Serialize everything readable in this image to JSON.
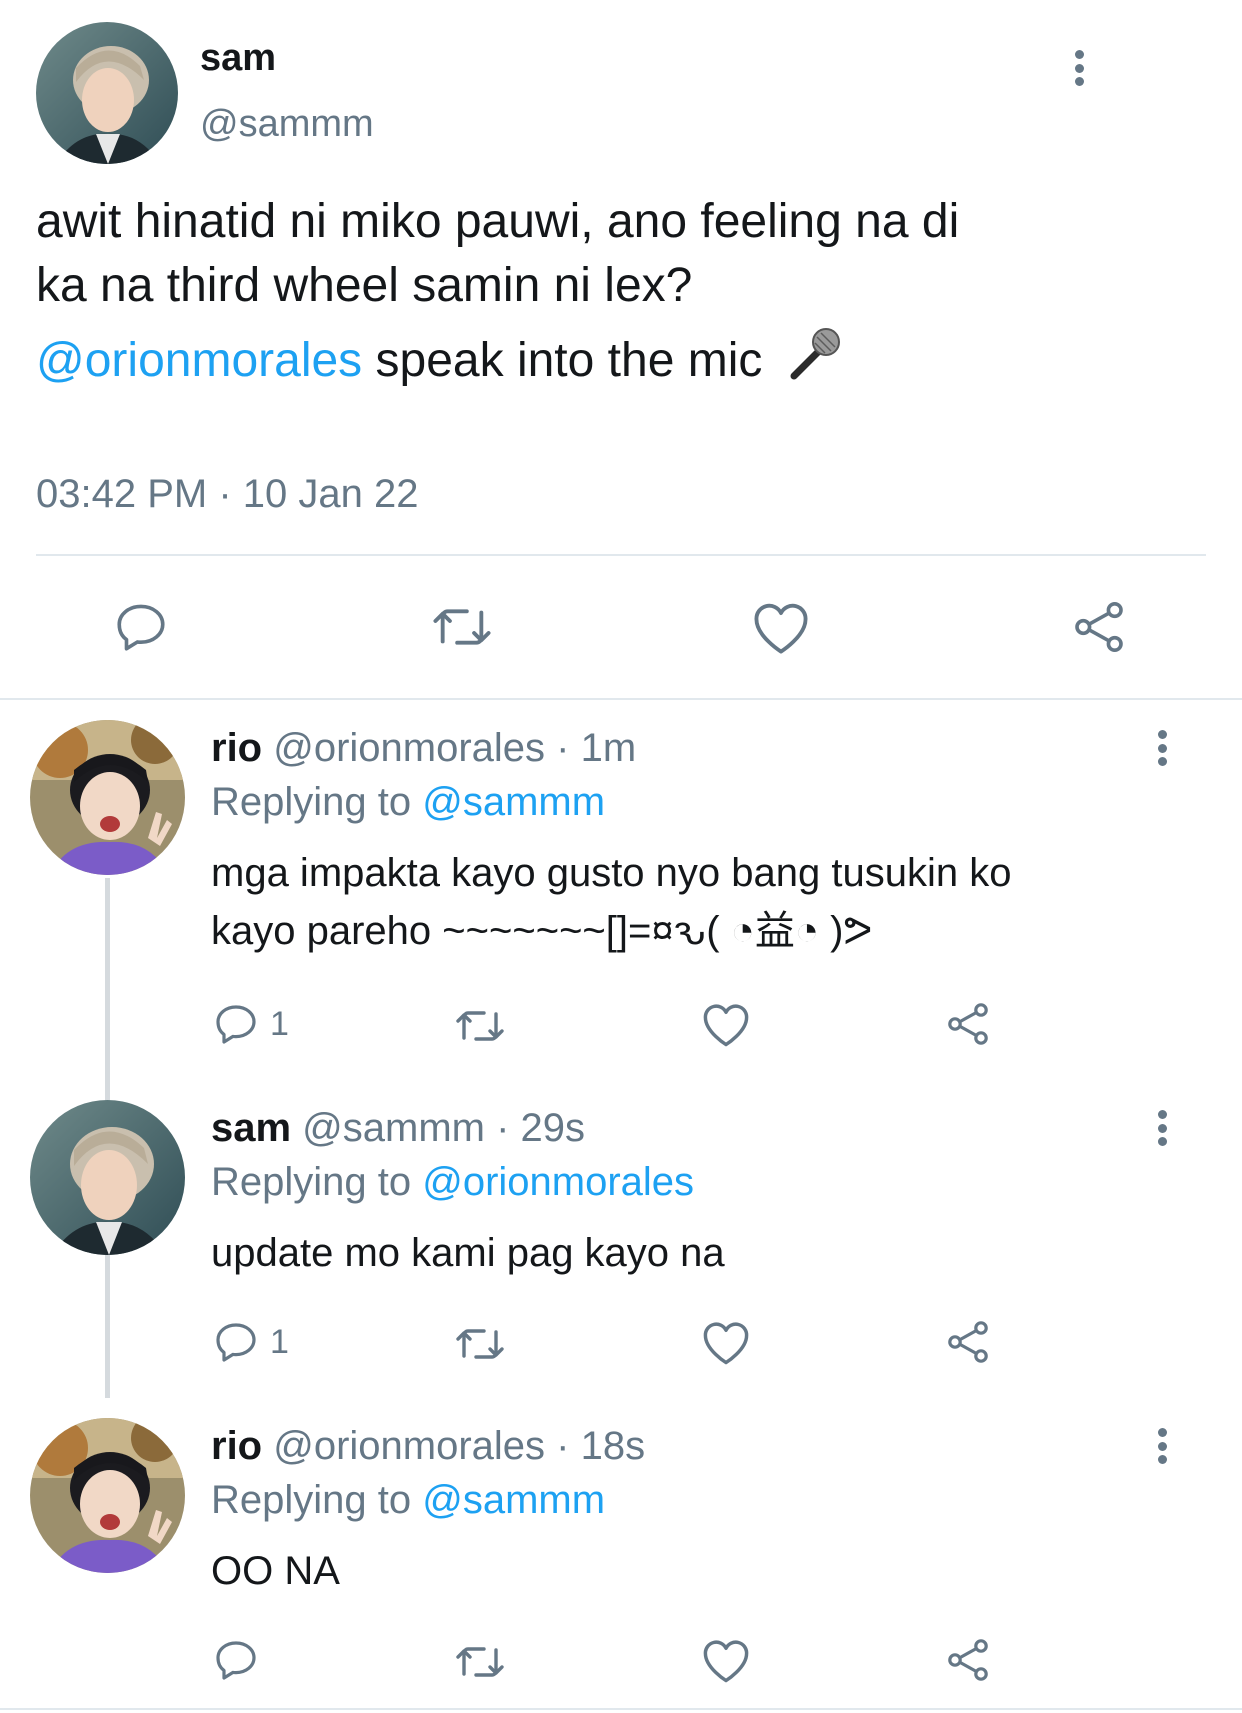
{
  "main_tweet": {
    "name": "sam",
    "handle": "@sammm",
    "text_line1": "awit hinatid ni miko pauwi, ano feeling na di",
    "text_line2": "ka na third wheel samin ni lex?",
    "mention": "@orionmorales",
    "text_after_mention": " speak into the mic",
    "emoji": "microphone",
    "timestamp": "03:42 PM · 10 Jan 22",
    "icons": [
      "reply-icon",
      "retweet-icon",
      "like-icon",
      "share-icon"
    ]
  },
  "replies": [
    {
      "name": "rio",
      "handle_time": " @orionmorales · 1m",
      "replying_label": "Replying to ",
      "replying_to": "@sammm",
      "text_line1": "mga impakta kayo gusto nyo bang tusukin ko",
      "text_line2": "kayo pareho ~~~~~~~[]=¤ԅ( ◔益◔ )ᕗ",
      "reply_count": "1"
    },
    {
      "name": "sam",
      "handle_time": " @sammm · 29s",
      "replying_label": "Replying to ",
      "replying_to": "@orionmorales",
      "text_line1": "update mo kami pag kayo na",
      "reply_count": "1"
    },
    {
      "name": "rio",
      "handle_time": " @orionmorales · 18s",
      "replying_label": "Replying to ",
      "replying_to": "@sammm",
      "text_line1": "OO NA",
      "reply_count": ""
    }
  ],
  "colors": {
    "link": "#1da1f2",
    "secondary": "#657786",
    "divider": "#e1e8ed",
    "text": "#14171a"
  }
}
